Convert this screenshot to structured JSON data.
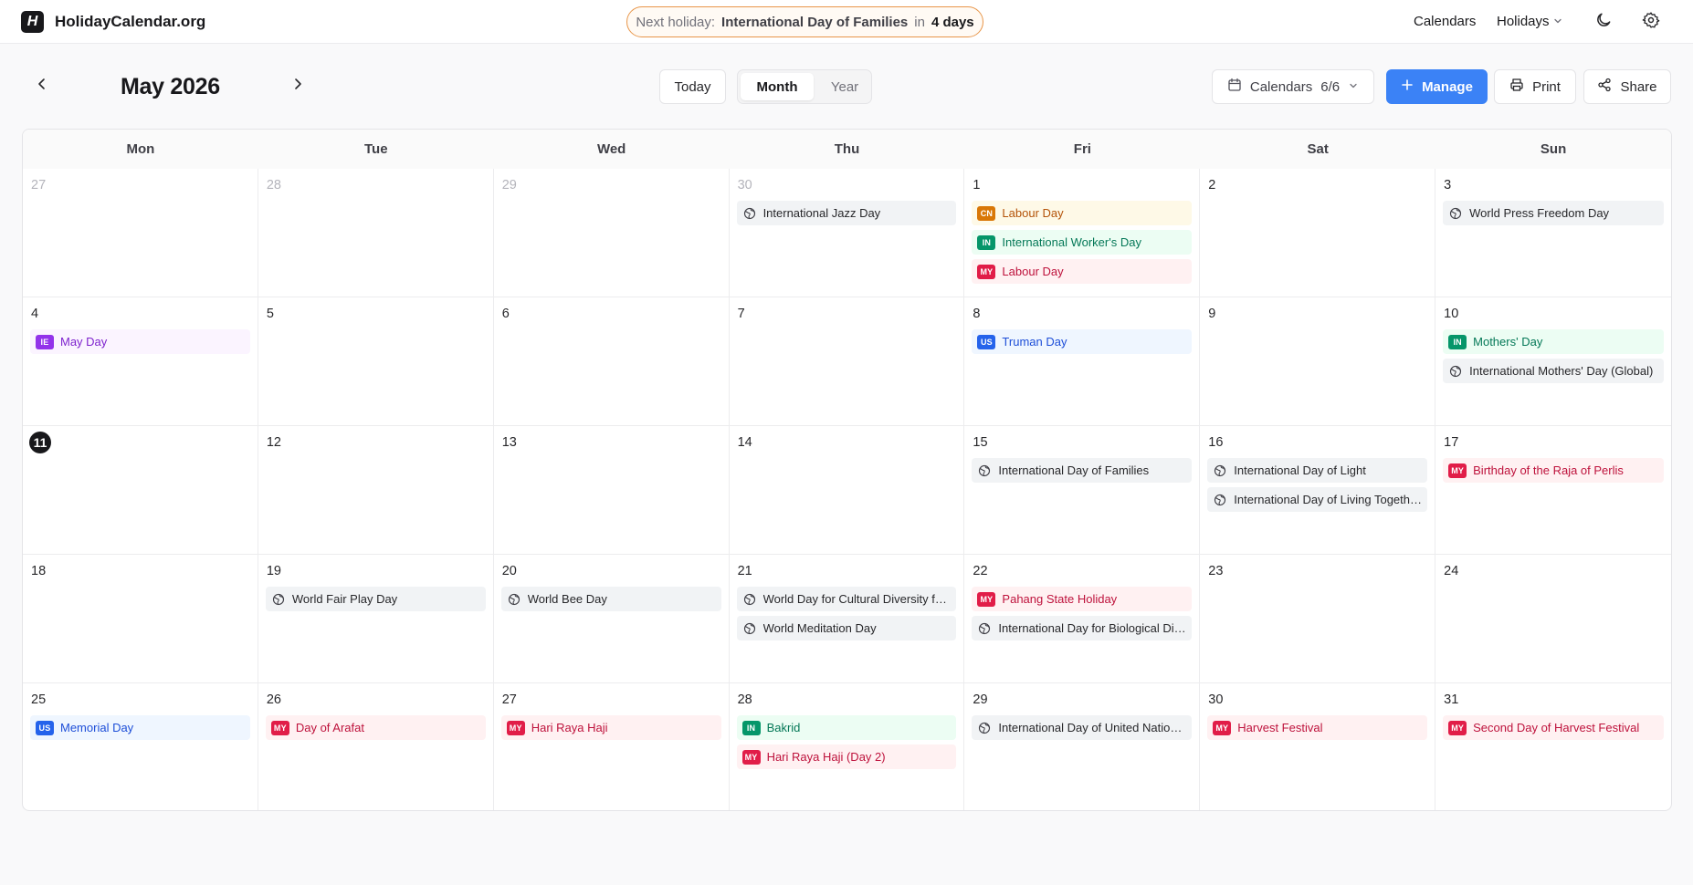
{
  "app": {
    "logo_letter": "H",
    "brand": "HolidayCalendar.org"
  },
  "next_holiday": {
    "label": "Next holiday:",
    "name": "International Day of Families",
    "in_word": "in",
    "countdown": "4 days"
  },
  "nav": {
    "calendars": "Calendars",
    "holidays": "Holidays"
  },
  "toolbar": {
    "month_title": "May 2026",
    "today": "Today",
    "view_month": "Month",
    "view_year": "Year",
    "calendars_label": "Calendars",
    "calendars_count": "6/6",
    "manage": "Manage",
    "print": "Print",
    "share": "Share"
  },
  "weekdays": [
    "Mon",
    "Tue",
    "Wed",
    "Thu",
    "Fri",
    "Sat",
    "Sun"
  ],
  "colors": {
    "accent": "#3b82f6",
    "pill_border": "#e8964a",
    "CN": "#d97706",
    "IN": "#059669",
    "MY": "#e11d48",
    "US": "#2563eb",
    "IE": "#9333ea"
  },
  "days": [
    {
      "num": "27",
      "other": true,
      "events": []
    },
    {
      "num": "28",
      "other": true,
      "events": []
    },
    {
      "num": "29",
      "other": true,
      "events": []
    },
    {
      "num": "30",
      "other": true,
      "events": [
        {
          "cc": "INTL",
          "name": "International Jazz Day"
        }
      ]
    },
    {
      "num": "1",
      "events": [
        {
          "cc": "CN",
          "name": "Labour Day"
        },
        {
          "cc": "IN",
          "name": "International Worker's Day"
        },
        {
          "cc": "MY",
          "name": "Labour Day"
        }
      ]
    },
    {
      "num": "2",
      "events": []
    },
    {
      "num": "3",
      "events": [
        {
          "cc": "INTL",
          "name": "World Press Freedom Day"
        }
      ]
    },
    {
      "num": "4",
      "events": [
        {
          "cc": "IE",
          "name": "May Day"
        }
      ]
    },
    {
      "num": "5",
      "events": []
    },
    {
      "num": "6",
      "events": []
    },
    {
      "num": "7",
      "events": []
    },
    {
      "num": "8",
      "events": [
        {
          "cc": "US",
          "name": "Truman Day"
        }
      ]
    },
    {
      "num": "9",
      "events": []
    },
    {
      "num": "10",
      "events": [
        {
          "cc": "IN",
          "name": "Mothers' Day"
        },
        {
          "cc": "INTL",
          "name": "International Mothers' Day (Global)"
        }
      ]
    },
    {
      "num": "11",
      "today": true,
      "events": []
    },
    {
      "num": "12",
      "events": []
    },
    {
      "num": "13",
      "events": []
    },
    {
      "num": "14",
      "events": []
    },
    {
      "num": "15",
      "events": [
        {
          "cc": "INTL",
          "name": "International Day of Families"
        }
      ]
    },
    {
      "num": "16",
      "events": [
        {
          "cc": "INTL",
          "name": "International Day of Light"
        },
        {
          "cc": "INTL",
          "name": "International Day of Living Together in Peace"
        }
      ]
    },
    {
      "num": "17",
      "events": [
        {
          "cc": "MY",
          "name": "Birthday of the Raja of Perlis"
        }
      ]
    },
    {
      "num": "18",
      "events": []
    },
    {
      "num": "19",
      "events": [
        {
          "cc": "INTL",
          "name": "World Fair Play Day"
        }
      ]
    },
    {
      "num": "20",
      "events": [
        {
          "cc": "INTL",
          "name": "World Bee Day"
        }
      ]
    },
    {
      "num": "21",
      "events": [
        {
          "cc": "INTL",
          "name": "World Day for Cultural Diversity for Dialogue and Development"
        },
        {
          "cc": "INTL",
          "name": "World Meditation Day"
        }
      ]
    },
    {
      "num": "22",
      "events": [
        {
          "cc": "MY",
          "name": "Pahang State Holiday"
        },
        {
          "cc": "INTL",
          "name": "International Day for Biological Diversity"
        }
      ]
    },
    {
      "num": "23",
      "events": []
    },
    {
      "num": "24",
      "events": []
    },
    {
      "num": "25",
      "events": [
        {
          "cc": "US",
          "name": "Memorial Day"
        }
      ]
    },
    {
      "num": "26",
      "events": [
        {
          "cc": "MY",
          "name": "Day of Arafat"
        }
      ]
    },
    {
      "num": "27",
      "events": [
        {
          "cc": "MY",
          "name": "Hari Raya Haji"
        }
      ]
    },
    {
      "num": "28",
      "events": [
        {
          "cc": "IN",
          "name": "Bakrid"
        },
        {
          "cc": "MY",
          "name": "Hari Raya Haji (Day 2)"
        }
      ]
    },
    {
      "num": "29",
      "events": [
        {
          "cc": "INTL",
          "name": "International Day of United Nations Peacekeepers"
        }
      ]
    },
    {
      "num": "30",
      "events": [
        {
          "cc": "MY",
          "name": "Harvest Festival"
        }
      ]
    },
    {
      "num": "31",
      "events": [
        {
          "cc": "MY",
          "name": "Second Day of Harvest Festival"
        }
      ]
    }
  ]
}
